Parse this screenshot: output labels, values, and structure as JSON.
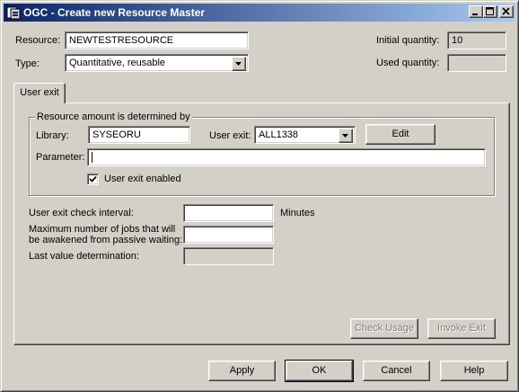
{
  "window": {
    "title": "OGC - Create new Resource Master"
  },
  "resource": {
    "label": "Resource:",
    "value": "NEWTESTRESOURCE"
  },
  "type": {
    "label": "Type:",
    "selected": "Quantitative, reusable"
  },
  "initial_quantity": {
    "label": "Initial quantity:",
    "value": "10"
  },
  "used_quantity": {
    "label": "Used quantity:",
    "value": ""
  },
  "tabs": [
    {
      "label": "User exit",
      "active": true
    }
  ],
  "group": {
    "title": "Resource amount is determined by",
    "library_label": "Library:",
    "library_value": "SYSEORU",
    "user_exit_label": "User exit:",
    "user_exit_selected": "ALL1338",
    "edit_label": "Edit",
    "parameter_label": "Parameter:",
    "parameter_value": "",
    "enabled_label": "User exit enabled",
    "enabled_checked": true
  },
  "check_interval": {
    "label": "User exit check interval:",
    "value": "",
    "unit": "Minutes"
  },
  "max_jobs": {
    "label_line1": "Maximum number of jobs that will",
    "label_line2": "be awakened from passive waiting:",
    "value": ""
  },
  "last_value": {
    "label": "Last value determination:",
    "value": ""
  },
  "actions": {
    "check_usage": "Check Usage",
    "invoke_exit": "Invoke Exit",
    "apply": "Apply",
    "ok": "OK",
    "cancel": "Cancel",
    "help": "Help"
  },
  "icons": {
    "title": "app-icon",
    "minimize": "minimize-icon",
    "maximize": "maximize-icon",
    "close": "close-icon",
    "dropdown": "chevron-down-icon",
    "check": "check-icon"
  },
  "colors": {
    "titlebar_start": "#0a246a",
    "titlebar_end": "#a6caf0",
    "face": "#d4d0c8"
  }
}
